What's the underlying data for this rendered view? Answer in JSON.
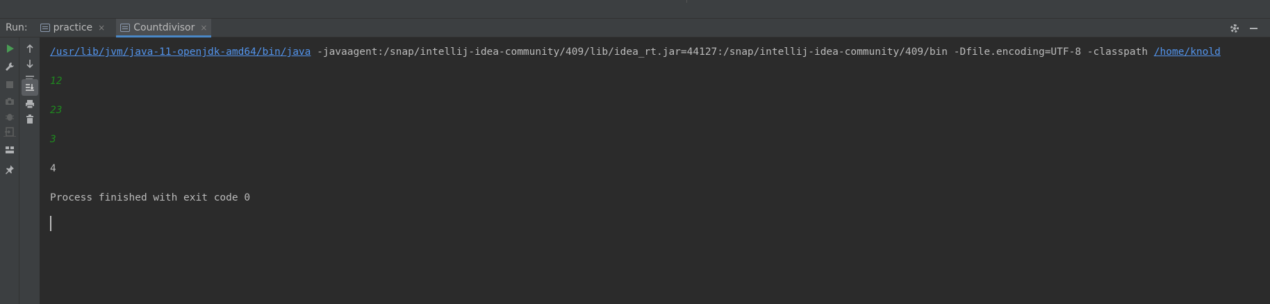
{
  "run_bar": {
    "label": "Run:",
    "tabs": [
      {
        "label": "practice",
        "close": "×",
        "active": false
      },
      {
        "label": "Countdivisor",
        "close": "×",
        "active": true
      }
    ]
  },
  "left_toolbar": {
    "primary": [
      "run-icon",
      "wrench-icon",
      "stop-icon",
      "camera-icon",
      "debug-icon",
      "exit-icon",
      "layout-icon",
      "pin-icon"
    ],
    "secondary": [
      "up-arrow-icon",
      "down-arrow-icon",
      "soft-wrap-icon",
      "scroll-to-end-icon",
      "print-icon",
      "trash-icon"
    ]
  },
  "console": {
    "command_java_path": "/usr/lib/jvm/java-11-openjdk-amd64/bin/java",
    "command_args": " -javaagent:/snap/intellij-idea-community/409/lib/idea_rt.jar=44127:/snap/intellij-idea-community/409/bin -Dfile.encoding=UTF-8 -classpath ",
    "command_classpath": "/home/knold",
    "inputs": [
      "12",
      "23",
      "3"
    ],
    "output": "4",
    "exit_message": "Process finished with exit code 0"
  },
  "colors": {
    "link": "#5394ec",
    "user_input": "#1f8a1f",
    "text": "#bbbbbb",
    "background": "#2b2b2b",
    "accent": "#4a88c7",
    "run_green": "#499c54"
  }
}
